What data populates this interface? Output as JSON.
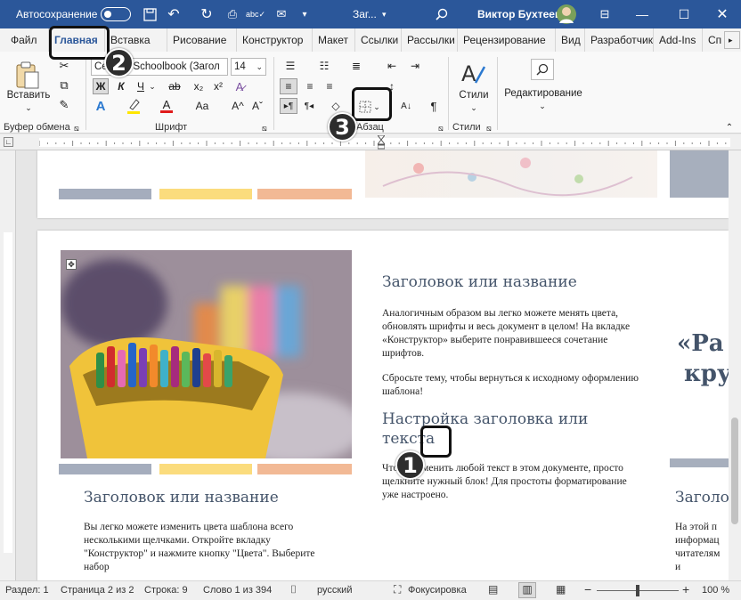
{
  "titlebar": {
    "autosave_label": "Автосохранение",
    "doc_name": "Заг...",
    "user_name": "Виктор Бухтеев"
  },
  "tabs": [
    "Файл",
    "Главная",
    "Вставка",
    "Рисование",
    "Конструктор",
    "Макет",
    "Ссылки",
    "Рассылки",
    "Рецензирование",
    "Вид",
    "Разработчик",
    "Add-Ins",
    "Сп"
  ],
  "ribbon": {
    "paste_label": "Вставить",
    "font_name": "Century Schoolbook (Загол",
    "font_size": "14",
    "bold": "Ж",
    "italic": "К",
    "underline": "Ч",
    "strike": "ab",
    "subscript": "x₂",
    "superscript": "x²",
    "font_color_letter": "A",
    "case_label": "Aa",
    "grow": "A^",
    "shrink": "Aˇ",
    "styles_label": "Стили",
    "editing_label": "Редактирование",
    "group_clipboard": "Буфер обмена",
    "group_font": "Шрифт",
    "group_paragraph": "Абзац",
    "group_styles": "Стили"
  },
  "page1": {
    "colors": [
      "#a5adbd",
      "#fbdc7d",
      "#f2b995"
    ]
  },
  "page2": {
    "left_heading": "Заголовок или название",
    "left_body": "Вы легко можете изменить цвета шаблона всего несколькими щелчками. Откройте вкладку \"Конструктор\" и нажмите кнопку \"Цвета\". Выберите набор",
    "mid_heading1": "Заголовок или название",
    "mid_body1": "Аналогичным образом вы легко можете менять цвета, обновлять шрифты и весь документ в целом! На вкладке «Конструктор» выберите понравившееся сочетание шрифтов.",
    "mid_body2": "Сбросьте тему, чтобы вернуться к исходному оформлению шаблона!",
    "mid_heading2_a": "Настройка заголовка или",
    "mid_heading2_b": "текста",
    "mid_body3": "Чтобы изменить любой текст в этом документе, просто щелкните нужный блок! Для простоты форматирование уже настроено.",
    "right_quote1": "«Ра",
    "right_quote2": "кру",
    "right_heading": "Заголо",
    "right_body": [
      "На этой п",
      "информац",
      "читателям",
      "и"
    ]
  },
  "statusbar": {
    "section": "Раздел: 1",
    "page": "Страница 2 из 2",
    "line": "Строка: 9",
    "words": "Слово 1 из 394",
    "language": "русский",
    "focus": "Фокусировка",
    "zoom": "100 %",
    "zoom_level": 0.5
  },
  "callouts": [
    "1",
    "2",
    "3"
  ],
  "colors": {
    "brand": "#2b579a",
    "heading": "#44546a",
    "callout": "#2d2d2d"
  }
}
